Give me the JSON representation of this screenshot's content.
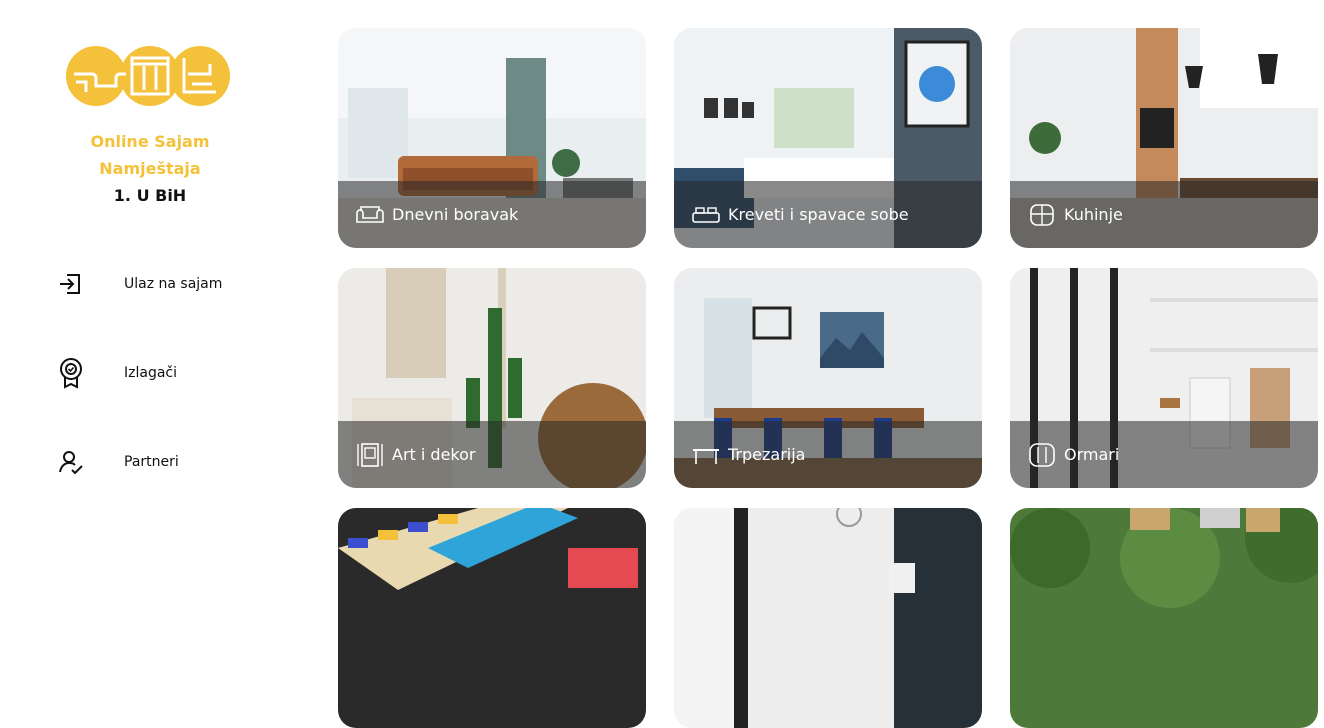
{
  "brand": {
    "line1": "Online Sajam",
    "line2": "Namještaja",
    "line3": "1. U BiH"
  },
  "nav": [
    {
      "label": "Ulaz na sajam",
      "icon": "login-icon"
    },
    {
      "label": "Izlagači",
      "icon": "award-badge-icon"
    },
    {
      "label": "Partneri",
      "icon": "user-check-icon"
    }
  ],
  "categories": [
    {
      "label": "Dnevni boravak",
      "icon": "sofa-icon"
    },
    {
      "label": "Kreveti i spavace sobe",
      "icon": "bed-icon"
    },
    {
      "label": "Kuhinje",
      "icon": "kitchen-icon"
    },
    {
      "label": "Art i dekor",
      "icon": "frame-icon"
    },
    {
      "label": "Trpezarija",
      "icon": "table-icon"
    },
    {
      "label": "Ormari",
      "icon": "wardrobe-icon"
    }
  ],
  "colors": {
    "brand": "#f4c23a",
    "overlay": "#282828"
  }
}
